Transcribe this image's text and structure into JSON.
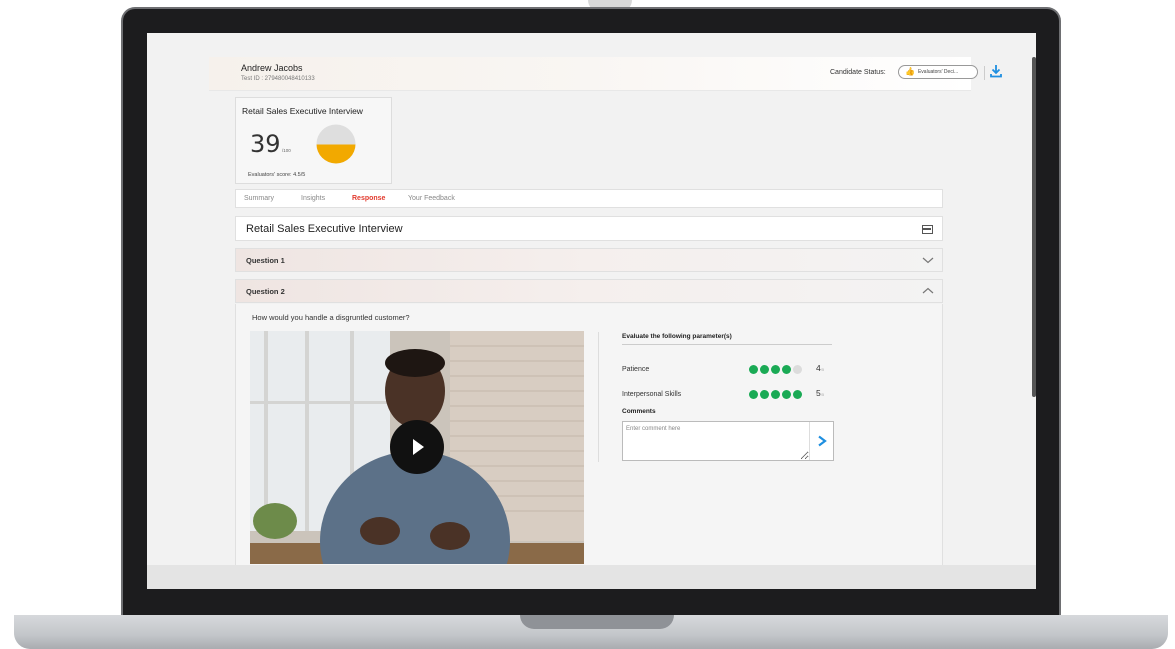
{
  "candidate": {
    "name": "Andrew Jacobs",
    "test_id": "Test ID : 279480048410133"
  },
  "status": {
    "label": "Candidate Status:",
    "value": "Evaluators' Deci..."
  },
  "score_card": {
    "title": "Retail Sales Executive Interview",
    "score": "39",
    "max": "/100",
    "score_fraction": 0.39,
    "evaluators_score": "Evaluators' score: 4.5/5"
  },
  "tabs": [
    {
      "label": "Summary"
    },
    {
      "label": "Insights"
    },
    {
      "label": "Response",
      "active": true
    },
    {
      "label": "Your Feedback"
    }
  ],
  "interview_title": "Retail Sales Executive Interview",
  "questions": [
    {
      "label": "Question 1",
      "expanded": false
    },
    {
      "label": "Question 2",
      "expanded": true
    }
  ],
  "question2": {
    "text": "How would you handle a disgruntled customer?",
    "evaluate_heading": "Evaluate the following parameter(s)",
    "parameters": [
      {
        "name": "Patience",
        "rating": 4,
        "rating_text": "4",
        "of": "/5"
      },
      {
        "name": "Interpersonal Skills",
        "rating": 5,
        "rating_text": "5",
        "of": "/5"
      }
    ],
    "comments_label": "Comments",
    "comment_placeholder": "Enter comment here"
  },
  "colors": {
    "accent_red": "#e23b2e",
    "rating_green": "#1aaa55",
    "gauge_orange": "#f2a900",
    "download_blue": "#1f8fe0"
  }
}
